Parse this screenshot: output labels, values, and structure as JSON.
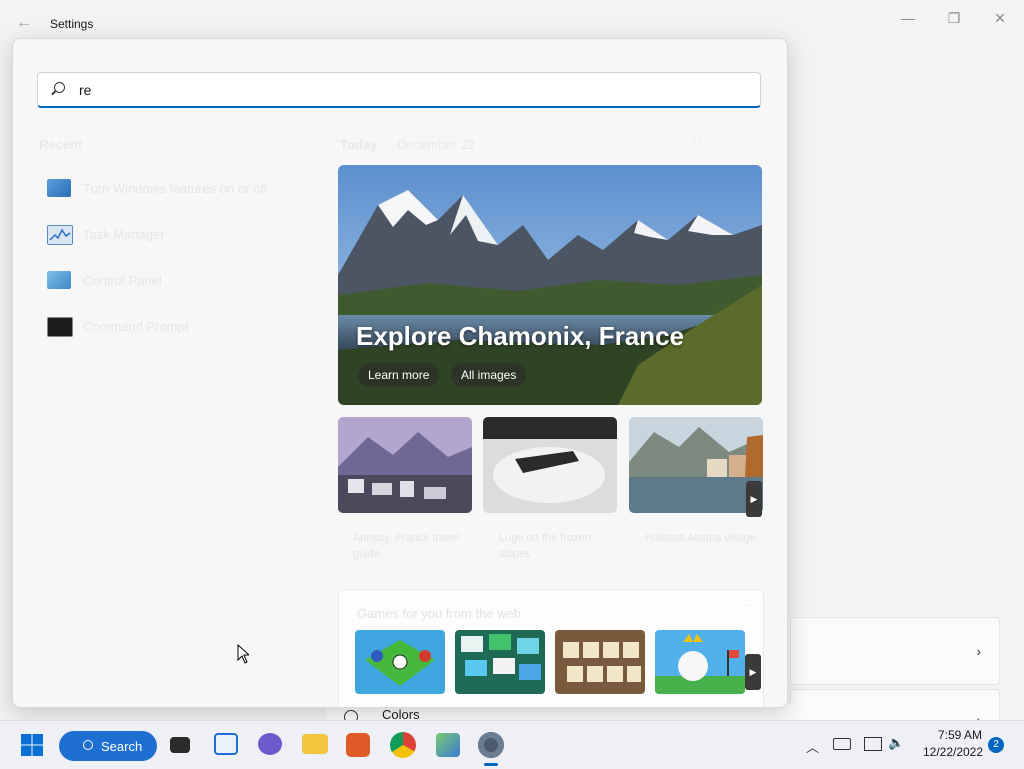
{
  "window": {
    "title": "Settings",
    "minimize": "—",
    "restore": "❐",
    "close": "✕"
  },
  "background": {
    "colors_label": "Colors"
  },
  "search": {
    "value": "re"
  },
  "recent": {
    "heading": "Recent",
    "items": [
      {
        "label": "Turn Windows features on or off"
      },
      {
        "label": "Task Manager"
      },
      {
        "label": "Control Panel"
      },
      {
        "label": "Command Prompt"
      }
    ]
  },
  "today": {
    "heading": "Today",
    "date": "December 22",
    "more": "···",
    "hero": {
      "title": "Explore Chamonix, France",
      "learn_more": "Learn more",
      "all_images": "All images"
    },
    "thumbs": [
      {
        "caption": "Annecy, France travel guide"
      },
      {
        "caption": "Luge on the frozen slopes"
      },
      {
        "caption": "Hallstatt Austria village"
      }
    ]
  },
  "games": {
    "title": "Games for you from the web",
    "more": "···"
  },
  "taskbar": {
    "search_label": "Search",
    "time": "7:59 AM",
    "date": "12/22/2022",
    "notifications": "2"
  },
  "colors": {
    "accent": "#0067c0",
    "taskbar_search": "#1f6fd3"
  }
}
